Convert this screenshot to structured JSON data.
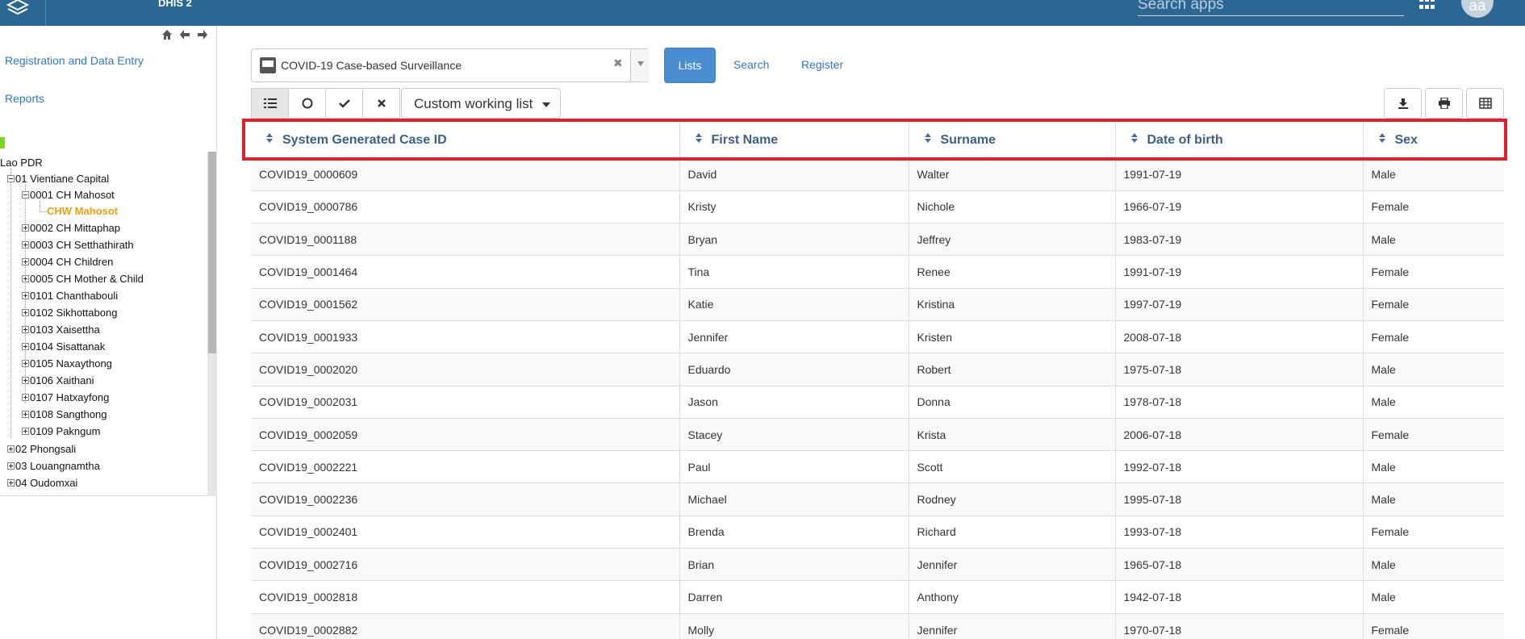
{
  "header": {
    "app_title": "DHIS 2",
    "search_placeholder": "Search apps",
    "avatar_initials": "aa",
    "bar_color": "#2c6693"
  },
  "sidebar": {
    "links": [
      "Registration and Data Entry",
      "Reports"
    ],
    "tree": [
      {
        "label": "Lao PDR",
        "state": "minus"
      },
      {
        "label": "01 Vientiane Capital",
        "state": "minus"
      },
      {
        "label": "0001 CH Mahosot",
        "state": "minus"
      },
      {
        "label": "CHW Mahosot",
        "state": "leaf",
        "selected": true
      },
      {
        "label": "0002 CH Mittaphap",
        "state": "plus"
      },
      {
        "label": "0003 CH Setthathirath",
        "state": "plus"
      },
      {
        "label": "0004 CH Children",
        "state": "plus"
      },
      {
        "label": "0005 CH Mother & Child",
        "state": "plus"
      },
      {
        "label": "0101 Chanthabouli",
        "state": "plus"
      },
      {
        "label": "0102 Sikhottabong",
        "state": "plus"
      },
      {
        "label": "0103 Xaisettha",
        "state": "plus"
      },
      {
        "label": "0104 Sisattanak",
        "state": "plus"
      },
      {
        "label": "0105 Naxaythong",
        "state": "plus"
      },
      {
        "label": "0106 Xaithani",
        "state": "plus"
      },
      {
        "label": "0107 Hatxayfong",
        "state": "plus"
      },
      {
        "label": "0108 Sangthong",
        "state": "plus"
      },
      {
        "label": "0109 Pakngum",
        "state": "plus"
      },
      {
        "label": "02 Phongsali",
        "state": "plus"
      },
      {
        "label": "03 Louangnamtha",
        "state": "plus"
      },
      {
        "label": "04 Oudomxai",
        "state": "plus"
      }
    ],
    "selected_color": "#f0a010"
  },
  "program": {
    "selected": "COVID-19 Case-based Surveillance",
    "clear_symbol": "✖"
  },
  "tabs": {
    "lists": "Lists",
    "search": "Search",
    "register": "Register",
    "active_color": "#4b8dd1"
  },
  "toolbar": {
    "view_icons": [
      "list-icon",
      "circle-icon",
      "check-icon",
      "x-icon"
    ],
    "working_list": "Custom working list",
    "right_icons": [
      "download-icon",
      "print-icon",
      "table-grid-icon"
    ]
  },
  "table": {
    "columns": [
      "System Generated Case ID",
      "First Name",
      "Surname",
      "Date of birth",
      "Sex"
    ],
    "rows": [
      [
        "COVID19_0000609",
        "David",
        "Walter",
        "1991-07-19",
        "Male"
      ],
      [
        "COVID19_0000786",
        "Kristy",
        "Nichole",
        "1966-07-19",
        "Female"
      ],
      [
        "COVID19_0001188",
        "Bryan",
        "Jeffrey",
        "1983-07-19",
        "Male"
      ],
      [
        "COVID19_0001464",
        "Tina",
        "Renee",
        "1991-07-19",
        "Female"
      ],
      [
        "COVID19_0001562",
        "Katie",
        "Kristina",
        "1997-07-19",
        "Female"
      ],
      [
        "COVID19_0001933",
        "Jennifer",
        "Kristen",
        "2008-07-18",
        "Female"
      ],
      [
        "COVID19_0002020",
        "Eduardo",
        "Robert",
        "1975-07-18",
        "Male"
      ],
      [
        "COVID19_0002031",
        "Jason",
        "Donna",
        "1978-07-18",
        "Male"
      ],
      [
        "COVID19_0002059",
        "Stacey",
        "Krista",
        "2006-07-18",
        "Female"
      ],
      [
        "COVID19_0002221",
        "Paul",
        "Scott",
        "1992-07-18",
        "Male"
      ],
      [
        "COVID19_0002236",
        "Michael",
        "Rodney",
        "1995-07-18",
        "Male"
      ],
      [
        "COVID19_0002401",
        "Brenda",
        "Richard",
        "1993-07-18",
        "Female"
      ],
      [
        "COVID19_0002716",
        "Brian",
        "Jennifer",
        "1965-07-18",
        "Male"
      ],
      [
        "COVID19_0002818",
        "Darren",
        "Anthony",
        "1942-07-18",
        "Male"
      ],
      [
        "COVID19_0002882",
        "Molly",
        "Jennifer",
        "1970-07-18",
        "Female"
      ]
    ],
    "highlight_color": "#e2202d"
  }
}
